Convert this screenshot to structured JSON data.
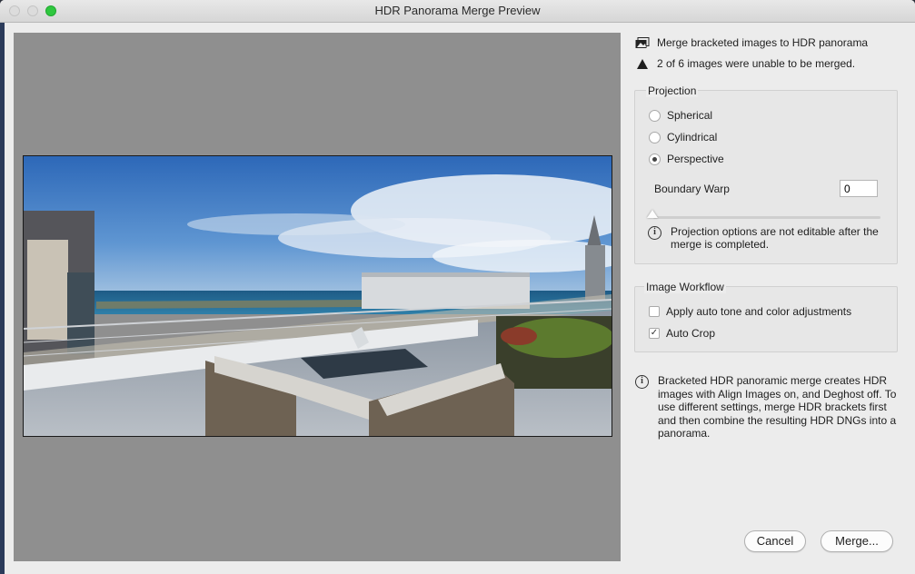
{
  "window": {
    "title": "HDR Panorama Merge Preview"
  },
  "header": {
    "merge_text": "Merge bracketed images to HDR panorama",
    "warning_text": "2 of 6 images were unable to be merged."
  },
  "projection": {
    "title": "Projection",
    "options": [
      "Spherical",
      "Cylindrical",
      "Perspective"
    ],
    "selected": "Perspective",
    "boundary_warp_label": "Boundary Warp",
    "boundary_warp_value": "0",
    "note": "Projection options are not editable after the merge is completed."
  },
  "image_workflow": {
    "title": "Image Workflow",
    "auto_tone_label": "Apply auto tone and color adjustments",
    "auto_tone_checked": false,
    "auto_crop_label": "Auto Crop",
    "auto_crop_checked": true
  },
  "info_text": "Bracketed HDR panoramic merge creates HDR images with Align Images on, and Deghost off. To use different settings, merge HDR brackets first and then combine the resulting HDR DNGs into a panorama.",
  "buttons": {
    "cancel": "Cancel",
    "merge": "Merge..."
  },
  "icons": {
    "merge": "stacked-images-icon",
    "warning": "warning-triangle-icon",
    "info": "info-circle-icon"
  },
  "colors": {
    "preview_bg": "#8f8f8f",
    "window_bg": "#ececec",
    "maximize": "#2fc73f"
  }
}
